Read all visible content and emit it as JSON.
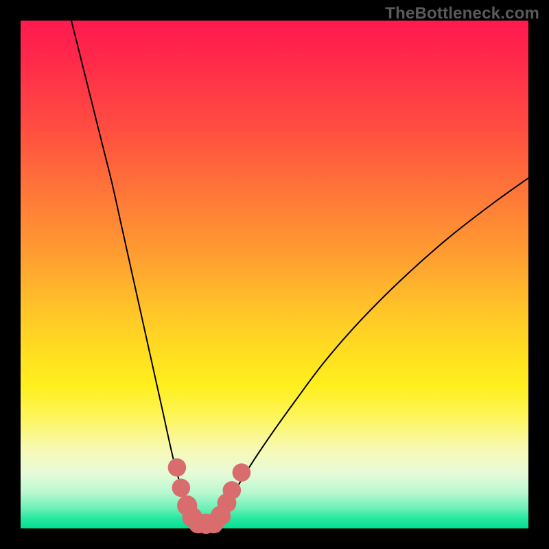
{
  "watermark": "TheBottleneck.com",
  "chart_data": {
    "type": "line",
    "title": "",
    "xlabel": "",
    "ylabel": "",
    "xlim": [
      0,
      100
    ],
    "ylim": [
      0,
      100
    ],
    "series": [
      {
        "name": "left-curve",
        "x": [
          10,
          12,
          14,
          16,
          18,
          20,
          22,
          24,
          26,
          28,
          30,
          31.5,
          33,
          34.2
        ],
        "y": [
          100,
          92,
          84,
          76,
          68,
          59,
          50,
          41,
          32,
          23,
          14,
          8.5,
          4,
          1.5
        ]
      },
      {
        "name": "right-curve",
        "x": [
          38.8,
          40,
          42,
          45,
          49,
          54,
          60,
          67,
          75,
          84,
          93,
          100
        ],
        "y": [
          1.5,
          3.5,
          7,
          12,
          18,
          25,
          33,
          41,
          49,
          57,
          64,
          69
        ]
      },
      {
        "name": "valley-floor",
        "x": [
          34.2,
          35.5,
          37,
          38.8
        ],
        "y": [
          1.5,
          0.9,
          0.9,
          1.5
        ]
      }
    ],
    "markers": [
      {
        "series": "left-curve",
        "x": 30.8,
        "y": 12,
        "r": 1.4
      },
      {
        "series": "left-curve",
        "x": 31.6,
        "y": 8,
        "r": 1.4
      },
      {
        "series": "left-curve",
        "x": 32.8,
        "y": 4.5,
        "r": 1.6
      },
      {
        "series": "left-curve",
        "x": 33.8,
        "y": 2.2,
        "r": 1.6
      },
      {
        "series": "valley-floor",
        "x": 35.0,
        "y": 1.0,
        "r": 1.6
      },
      {
        "series": "valley-floor",
        "x": 36.5,
        "y": 0.9,
        "r": 1.6
      },
      {
        "series": "valley-floor",
        "x": 38.0,
        "y": 1.0,
        "r": 1.6
      },
      {
        "series": "right-curve",
        "x": 39.4,
        "y": 2.5,
        "r": 1.6
      },
      {
        "series": "right-curve",
        "x": 40.6,
        "y": 5.0,
        "r": 1.5
      },
      {
        "series": "right-curve",
        "x": 41.6,
        "y": 7.5,
        "r": 1.4
      },
      {
        "series": "right-curve",
        "x": 43.5,
        "y": 11.0,
        "r": 1.4
      }
    ],
    "colors": {
      "curve": "#000000",
      "marker": "#d96d6d",
      "valley_stroke": "#d96d6d"
    }
  }
}
